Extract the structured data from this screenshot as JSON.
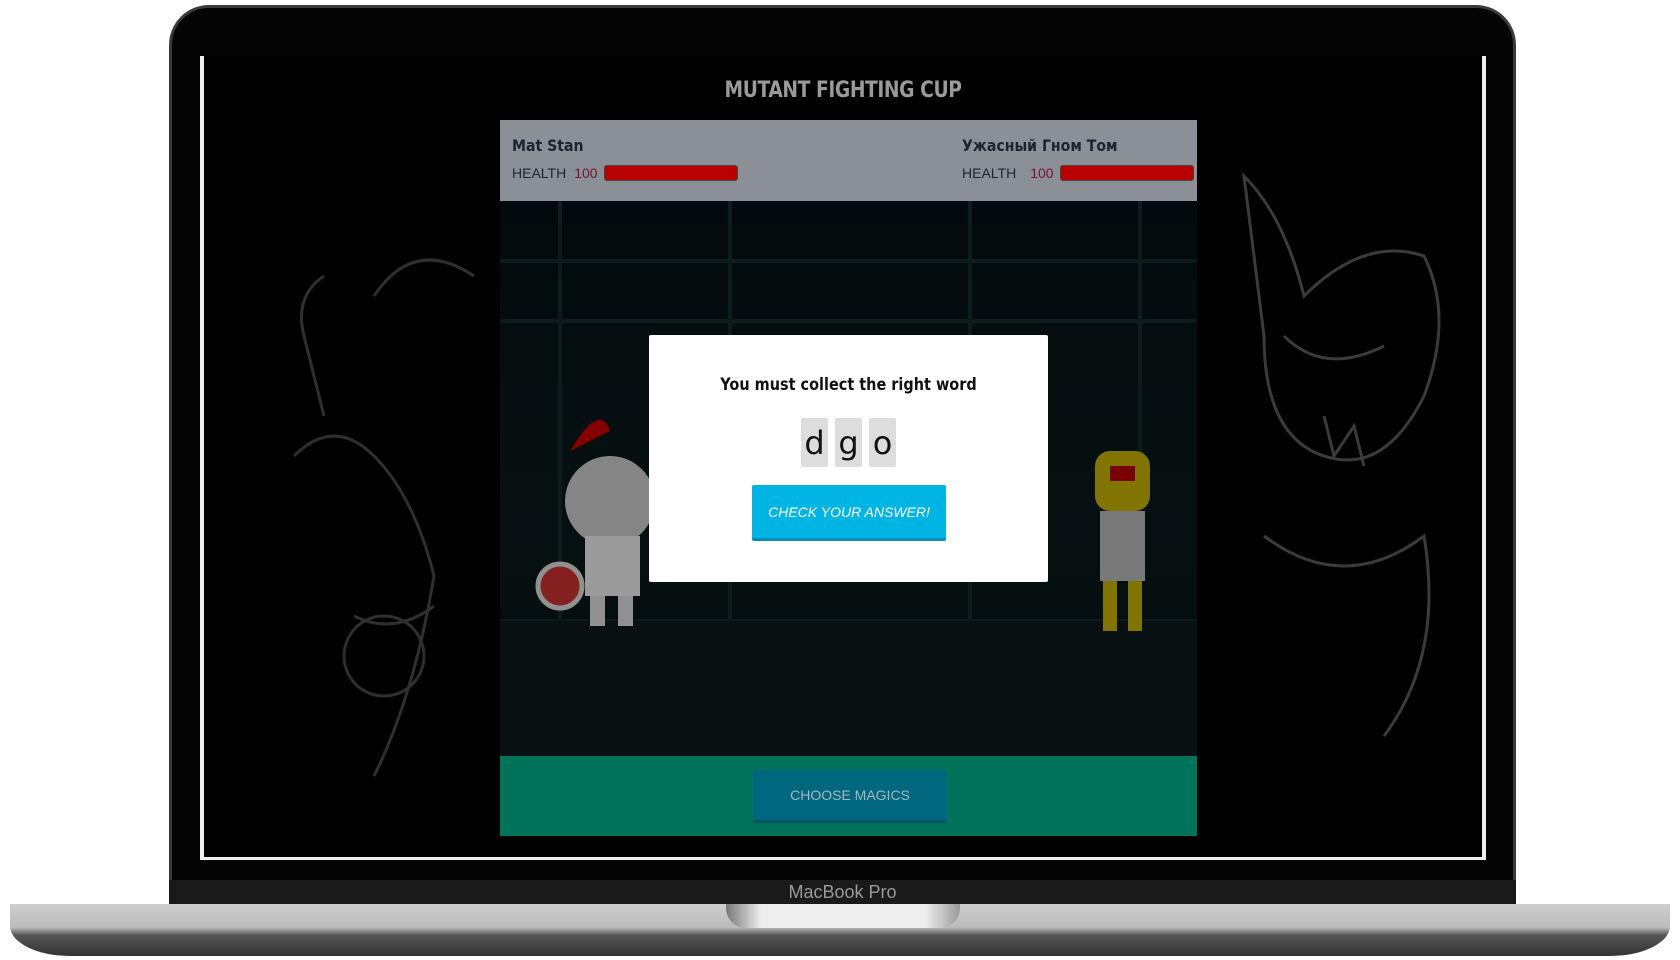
{
  "device_label": "MacBook Pro",
  "game": {
    "title": "MUTANT FIGHTING CUP",
    "player1": {
      "name": "Mat Stan",
      "health_label": "HEALTH",
      "health": "100",
      "health_fraction": 1.0
    },
    "player2": {
      "name": "Ужасный Гном Том",
      "health_label": "HEALTH",
      "health": "100",
      "health_fraction": 1.0
    },
    "choose_magics_label": "CHOOSE MAGICS"
  },
  "modal": {
    "title": "You must collect the right word",
    "letters": [
      "d",
      "g",
      "o"
    ],
    "check_label": "CHECK YOUR ANSWER!"
  },
  "colors": {
    "health_bar": "#b80000",
    "check_button": "#00b4e4",
    "footer_panel": "#00735a",
    "magics_button": "#00677f"
  }
}
